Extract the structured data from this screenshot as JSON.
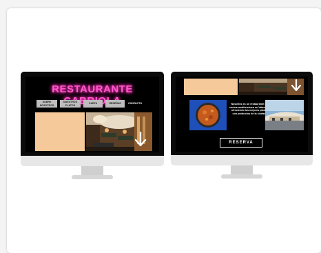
{
  "left_monitor": {
    "title": "RESTAURANTE CABRIOLA",
    "nav": [
      "SOBRE NOSOTROS",
      "NUESTROS PLATOS",
      "CARTA",
      "RESEÑAS",
      "CONTACTO"
    ]
  },
  "right_monitor": {
    "description": "Nosotros es un restaurante de cocina mediterránea en Valencia, ofreciendo los mejores platos con productos de la ciudad.",
    "button": "RESERVA"
  },
  "colors": {
    "neon": "#ff5ad0",
    "beige": "#f6c99a",
    "screen_bg": "#000000"
  },
  "icons": [
    "scroll-down-arrow-icon"
  ]
}
